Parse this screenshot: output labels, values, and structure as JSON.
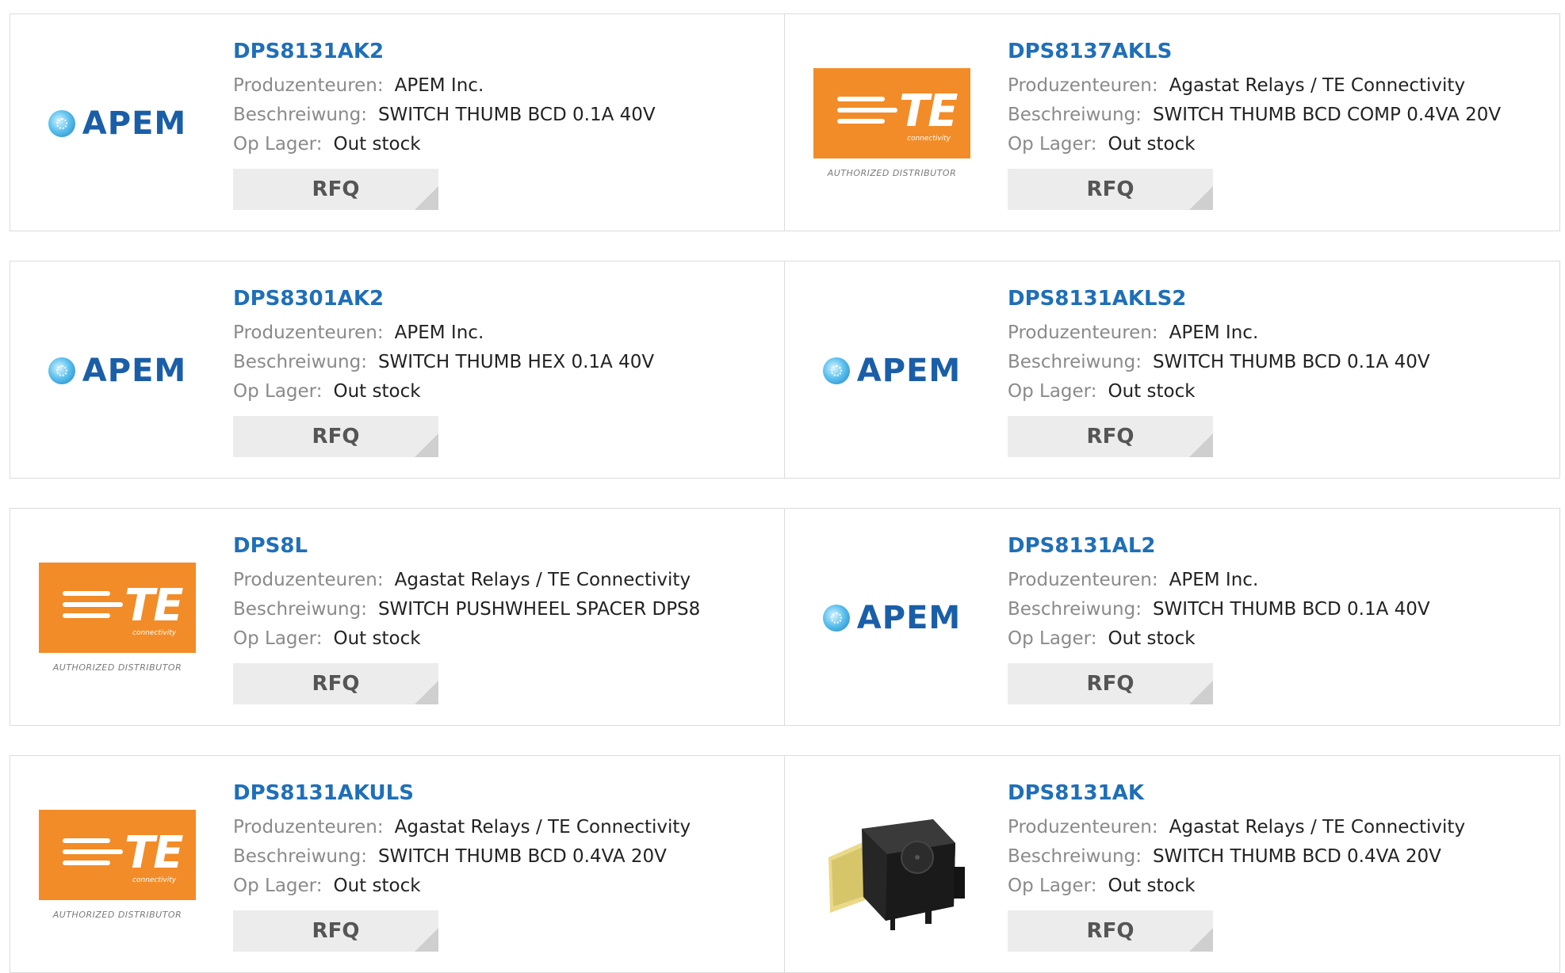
{
  "labels": {
    "manufacturer": "Produzenteuren:",
    "description": "Beschreiwung:",
    "stock": "Op Lager:",
    "rfq": "RFQ"
  },
  "products": [
    {
      "part": "DPS8131AK2",
      "manufacturer": "APEM Inc.",
      "description": "SWITCH THUMB BCD 0.1A 40V",
      "stock": "Out stock",
      "logo": "apem-logo",
      "logo_text": "APEM"
    },
    {
      "part": "DPS8137AKLS",
      "manufacturer": "Agastat Relays / TE Connectivity",
      "description": "SWITCH THUMB BCD COMP 0.4VA 20V",
      "stock": "Out stock",
      "logo": "te-logo",
      "logo_text": "TE",
      "logo_sub": "connectivity",
      "logo_caption": "AUTHORIZED DISTRIBUTOR"
    },
    {
      "part": "DPS8301AK2",
      "manufacturer": "APEM Inc.",
      "description": "SWITCH THUMB HEX 0.1A 40V",
      "stock": "Out stock",
      "logo": "apem-logo",
      "logo_text": "APEM"
    },
    {
      "part": "DPS8131AKLS2",
      "manufacturer": "APEM Inc.",
      "description": "SWITCH THUMB BCD 0.1A 40V",
      "stock": "Out stock",
      "logo": "apem-logo",
      "logo_text": "APEM"
    },
    {
      "part": "DPS8L",
      "manufacturer": "Agastat Relays / TE Connectivity",
      "description": "SWITCH PUSHWHEEL SPACER DPS8",
      "stock": "Out stock",
      "logo": "te-logo",
      "logo_text": "TE",
      "logo_sub": "connectivity",
      "logo_caption": "AUTHORIZED DISTRIBUTOR"
    },
    {
      "part": "DPS8131AL2",
      "manufacturer": "APEM Inc.",
      "description": "SWITCH THUMB BCD 0.1A 40V",
      "stock": "Out stock",
      "logo": "apem-logo",
      "logo_text": "APEM"
    },
    {
      "part": "DPS8131AKULS",
      "manufacturer": "Agastat Relays / TE Connectivity",
      "description": "SWITCH THUMB BCD 0.4VA 20V",
      "stock": "Out stock",
      "logo": "te-logo",
      "logo_text": "TE",
      "logo_sub": "connectivity",
      "logo_caption": "AUTHORIZED DISTRIBUTOR"
    },
    {
      "part": "DPS8131AK",
      "manufacturer": "Agastat Relays / TE Connectivity",
      "description": "SWITCH THUMB BCD 0.4VA 20V",
      "stock": "Out stock",
      "logo": "product-photo"
    }
  ],
  "colors": {
    "part_link": "#1f6fb8",
    "te_orange": "#f28c28",
    "apem_blue": "#1a5ea8",
    "rfq_bg": "#ececec"
  }
}
